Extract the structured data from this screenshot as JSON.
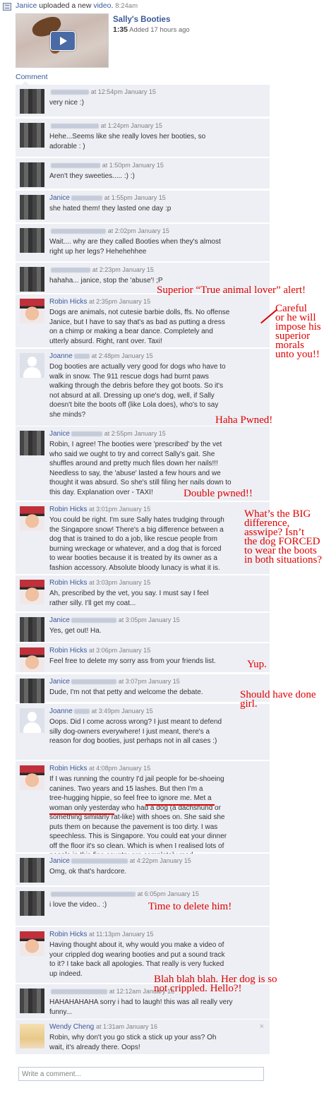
{
  "story": {
    "actor": "Janice",
    "action_prefix": " uploaded a new ",
    "action_link": "video",
    "punct": ".",
    "time": "8:24am"
  },
  "video": {
    "title": "Sally's Booties",
    "duration": "1:35",
    "added": "Added 17 hours ago"
  },
  "comment_link": "Comment",
  "comments": [
    {
      "name": "",
      "time": "at 12:54pm January 15",
      "text": "very nice :)"
    },
    {
      "name": "",
      "time": "at 1:24pm January 15",
      "text": "Hehe...Seems like she really loves her booties, so\nadorable : )"
    },
    {
      "name": "",
      "time": "at 1:50pm January 15",
      "text": "Aren't they sweeties..... :) :)"
    },
    {
      "name": "Janice",
      "time": "at 1:55pm January 15",
      "text": "she hated them! they lasted one day :p"
    },
    {
      "name": "",
      "time": "at 2:02pm January 15",
      "text": "Wait.... why are they called Booties when they's almost\nright up her legs? Hehehehhee"
    },
    {
      "name": "",
      "time": "at 2:23pm January 15",
      "text": "hahaha... janice, stop the 'abuse'! ;P"
    },
    {
      "name": "Robin Hicks",
      "time": "at 2:35pm January 15",
      "text": "Dogs are animals, not cutesie barbie dolls, ffs. No offense\nJanice, but I have to say that's as bad as putting a dress\non a chimp or making a bear dance. Completely and\nutterly absurd. Right, rant over. Taxi!"
    },
    {
      "name": "Joanne",
      "time": "at 2:48pm January 15",
      "text": "Dog booties are actually very good for dogs who have to\nwalk in snow. The 911 rescue dogs had burnt paws\nwalking through the debris before they got boots. So it's\nnot absurd at all. Dressing up one's dog, well, if Sally\ndoesn't bite the boots off (like Lola does), who's to say\nshe minds?"
    },
    {
      "name": "Janice",
      "time": "at 2:55pm January 15",
      "text": "Robin, I agree! The booties were 'prescribed' by the vet\nwho said we ought to try and correct Sally's gait. She\nshuffles around and pretty much files down her nails!!!\nNeedless to say, the 'abuse' lasted a few hours and we\nthought it was absurd. So she's still filing her nails down to\nthis day. Explanation over - TAXI!"
    },
    {
      "name": "Robin Hicks",
      "time": "at 3:01pm January 15",
      "text": "You could be right. I'm sure Sally hates trudging through\nthe Singapore snow! There's a big difference between a\ndog that is trained to do a job, like rescue people from\nburning wreckage or whatever, and a dog that is forced\nto wear booties because it is treated by its owner as a\nfashion accessory. Absolute bloody lunacy is what it is."
    },
    {
      "name": "Robin Hicks",
      "time": "at 3:03pm January 15",
      "text": "Ah, prescribed by the vet, you say. I must say I feel\nrather silly. I'll get my coat..."
    },
    {
      "name": "Janice",
      "time": "at 3:05pm January 15",
      "text": "Yes, get out! Ha."
    },
    {
      "name": "Robin Hicks",
      "time": "at 3:06pm January 15",
      "text": "Feel free to delete my sorry ass from your friends list."
    },
    {
      "name": "Janice",
      "time": "at 3:07pm January 15",
      "text": "Dude, I'm not that petty and welcome the debate."
    },
    {
      "name": "Joanne",
      "time": "at 3:49pm January 15",
      "text": "Oops. Did I come across wrong? I just meant to defend\nsilly dog-owners everywhere! I just meant, there's a\nreason for dog booties, just perhaps not in all cases :)"
    },
    {
      "name": "Robin Hicks",
      "time": "at 4:08pm January 15",
      "text": "If I was running the country I'd jail people for be-shoeing\ncanines. Two years and 15 lashes. But then I'm a\ntree-hugging hippie, so feel free to ignore me. Met a\nwoman only yesterday who had a dog (a dachshund or\nsomething similarly rat-like) with shoes on. She said she\nputs them on because the pavement is too dirty. I was\nspeechless. This is Singapore. You could eat your dinner\noff the floor it's so clean. Which is when I realised lots of\npeople in this fine country are completely mad."
    },
    {
      "name": "Janice",
      "time": "at 4:22pm January 15",
      "text": "Omg, ok that's hardcore."
    },
    {
      "name": "",
      "time": "at 6:05pm January 15",
      "text": "i love the video.. :)"
    },
    {
      "name": "Robin Hicks",
      "time": "at 11:13pm January 15",
      "text": "Having thought about it, why would you make a video of\nyour crippled dog wearing booties and put a sound track\nto it? I take back all apologies. That really is very fucked\nup indeed."
    },
    {
      "name": "",
      "time": "at 12:12am January 16",
      "text": "HAHAHAHAHA sorry i had to laugh! this was all really very\nfunny..."
    },
    {
      "name": "Wendy Cheng",
      "time": "at 1:31am January 16",
      "text": "Robin, why don't you go stick a stick up your ass? Oh\nwait, it's already there. Oops!",
      "delete": "×"
    }
  ],
  "input_placeholder": "Write a comment...",
  "annotations": [
    "Superior “True animal lover” alert!",
    "Careful\nor he will\nimpose his\nsuperior\nmorals\nunto you!!",
    "Haha Pwned!",
    "Double pwned!!",
    "What’s the BIG\ndifference,\nasswipe? Isn’t\nthe dog FORCED\nto wear the boots\nin both situations?",
    "Yup.",
    "Should have done\ngirl.",
    "Time to delete him!",
    "Blah blah blah. Her dog is so\nnot crippled. Hello?!"
  ]
}
